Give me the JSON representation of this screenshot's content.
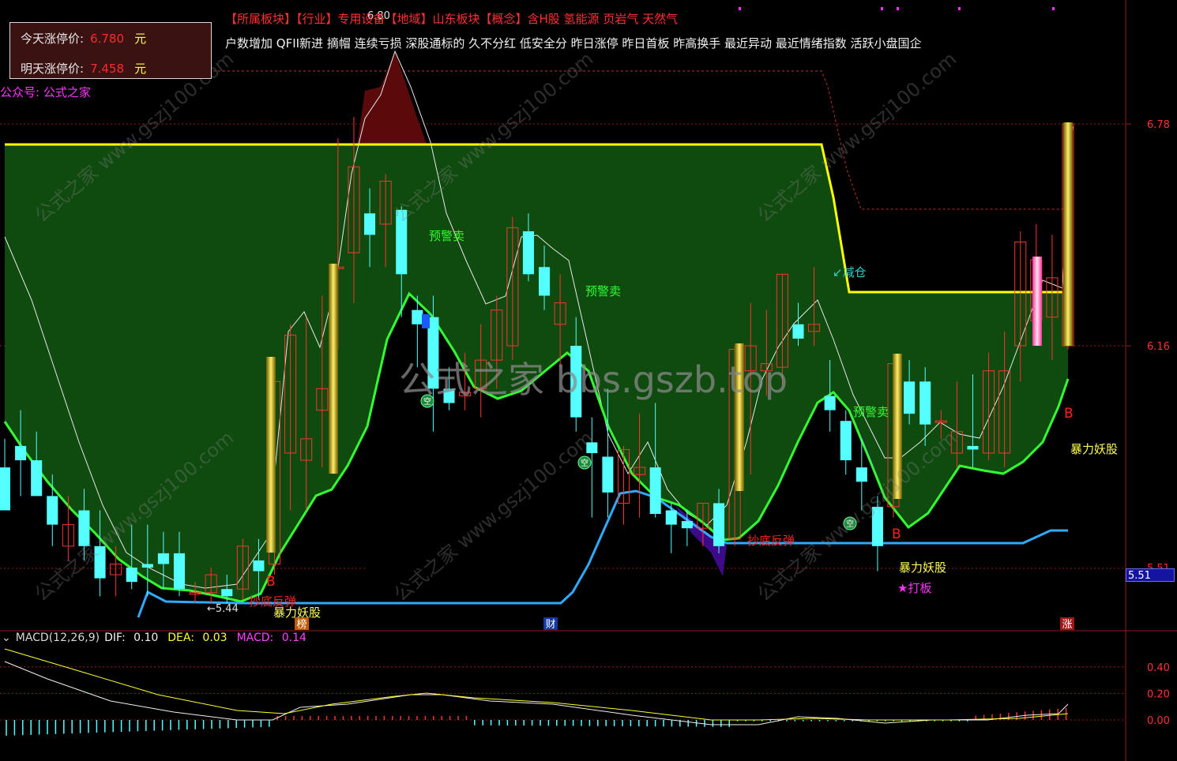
{
  "header_line1": "【所属板块】【行业】专用设备【地域】山东板块【概念】含H股 氢能源 页岩气 天然气",
  "header_line2": "户数增加 QFII新进 摘帽 连续亏损 深股通标的 久不分红 低安全分 昨日涨停 昨日首板 昨高换手 最近异动 最近情绪指数 活跃小盘国企",
  "limit_box": {
    "today_label": "今天涨停价:",
    "today_value": "6.780",
    "tomorrow_label": "明天涨停价:",
    "tomorrow_value": "7.458",
    "unit": "元"
  },
  "wechat_label": "公众号: 公式之家",
  "watermark_center": "公式之家 bbs.gszb.top",
  "watermark_small": "公式之家 www.gszj100.com",
  "price_axis": {
    "ticks": [
      "6.78",
      "6.16"
    ],
    "partial_tick": "5.51",
    "current_badge": "5.51"
  },
  "annotations": {
    "warn_sell": "预警卖",
    "reduce": "减仓",
    "bottom_rebound": "抄底反弹",
    "violent_monster": "暴力妖股",
    "hit_board": "★打板",
    "buy": "B",
    "empty": "空",
    "low_marker": "5.44",
    "high_marker": "6.80",
    "bottom_tag_bang": "榜",
    "bottom_tag_cai": "财",
    "bottom_tag_zhang": "涨"
  },
  "macd": {
    "indicator_label": "MACD(12,26,9)",
    "dif_label": "DIF:",
    "dif_value": "0.10",
    "dea_label": "DEA:",
    "dea_value": "0.03",
    "macd_label": "MACD:",
    "macd_value": "0.14",
    "ticks": [
      "0.40",
      "0.20",
      "0.00"
    ]
  },
  "colors": {
    "up": "#ff3232",
    "down": "#54ffff",
    "green_fill": "#0f4a0f",
    "yellow_line": "#ffff00",
    "green_line": "#33ff33",
    "blue_line": "#2eaaff",
    "dark_red": "#5a0a0a",
    "grid": "#9a1a1a"
  },
  "chart_data": {
    "type": "candlestick",
    "price_axis_ticks": [
      6.78,
      6.16
    ],
    "price_range": [
      5.4,
      6.85
    ],
    "candles": [
      {
        "o": 5.82,
        "h": 5.9,
        "l": 5.7,
        "c": 5.7
      },
      {
        "o": 5.88,
        "h": 5.98,
        "l": 5.74,
        "c": 5.84
      },
      {
        "o": 5.84,
        "h": 5.92,
        "l": 5.74,
        "c": 5.74
      },
      {
        "o": 5.74,
        "h": 5.8,
        "l": 5.6,
        "c": 5.66
      },
      {
        "o": 5.6,
        "h": 5.74,
        "l": 5.56,
        "c": 5.66
      },
      {
        "o": 5.7,
        "h": 5.76,
        "l": 5.56,
        "c": 5.6
      },
      {
        "o": 5.6,
        "h": 5.7,
        "l": 5.46,
        "c": 5.51
      },
      {
        "o": 5.52,
        "h": 5.6,
        "l": 5.46,
        "c": 5.55
      },
      {
        "o": 5.54,
        "h": 5.66,
        "l": 5.48,
        "c": 5.5
      },
      {
        "o": 5.55,
        "h": 5.66,
        "l": 5.46,
        "c": 5.54
      },
      {
        "o": 5.58,
        "h": 5.64,
        "l": 5.48,
        "c": 5.55
      },
      {
        "o": 5.58,
        "h": 5.64,
        "l": 5.46,
        "c": 5.48
      },
      {
        "o": 5.47,
        "h": 5.5,
        "l": 5.44,
        "c": 5.47
      },
      {
        "o": 5.47,
        "h": 5.54,
        "l": 5.44,
        "c": 5.52
      },
      {
        "o": 5.48,
        "h": 5.52,
        "l": 5.44,
        "c": 5.46
      },
      {
        "o": 5.48,
        "h": 5.62,
        "l": 5.45,
        "c": 5.6
      },
      {
        "o": 5.56,
        "h": 5.62,
        "l": 5.45,
        "c": 5.53
      },
      {
        "o": 5.55,
        "h": 6.1,
        "l": 5.52,
        "c": 6.06
      },
      {
        "o": 5.86,
        "h": 6.22,
        "l": 5.7,
        "c": 6.19
      },
      {
        "o": 5.84,
        "h": 6.24,
        "l": 5.7,
        "c": 5.9
      },
      {
        "o": 5.98,
        "h": 6.3,
        "l": 5.82,
        "c": 6.04
      },
      {
        "o": 6.38,
        "h": 6.74,
        "l": 6.15,
        "c": 6.38
      },
      {
        "o": 6.42,
        "h": 6.8,
        "l": 6.28,
        "c": 6.66
      },
      {
        "o": 6.53,
        "h": 6.6,
        "l": 6.38,
        "c": 6.47
      },
      {
        "o": 6.5,
        "h": 6.64,
        "l": 6.38,
        "c": 6.62
      },
      {
        "o": 6.54,
        "h": 6.55,
        "l": 6.24,
        "c": 6.36
      },
      {
        "o": 6.26,
        "h": 6.3,
        "l": 6.1,
        "c": 6.22
      },
      {
        "o": 6.24,
        "h": 6.3,
        "l": 5.92,
        "c": 6.04
      },
      {
        "o": 6.04,
        "h": 6.1,
        "l": 5.98,
        "c": 6.0
      },
      {
        "o": 6.02,
        "h": 6.14,
        "l": 5.98,
        "c": 6.03
      },
      {
        "o": 6.04,
        "h": 6.22,
        "l": 5.96,
        "c": 6.12
      },
      {
        "o": 6.12,
        "h": 6.3,
        "l": 6.04,
        "c": 6.26
      },
      {
        "o": 6.16,
        "h": 6.52,
        "l": 6.12,
        "c": 6.49
      },
      {
        "o": 6.48,
        "h": 6.53,
        "l": 6.34,
        "c": 6.36
      },
      {
        "o": 6.38,
        "h": 6.44,
        "l": 6.26,
        "c": 6.3
      },
      {
        "o": 6.22,
        "h": 6.36,
        "l": 6.1,
        "c": 6.28
      },
      {
        "o": 6.16,
        "h": 6.24,
        "l": 5.92,
        "c": 5.96
      },
      {
        "o": 5.89,
        "h": 5.96,
        "l": 5.68,
        "c": 5.86
      },
      {
        "o": 5.85,
        "h": 6.04,
        "l": 5.68,
        "c": 5.75
      },
      {
        "o": 5.72,
        "h": 5.88,
        "l": 5.66,
        "c": 5.87
      },
      {
        "o": 5.8,
        "h": 5.97,
        "l": 5.68,
        "c": 5.82
      },
      {
        "o": 5.82,
        "h": 6.0,
        "l": 5.68,
        "c": 5.69
      },
      {
        "o": 5.7,
        "h": 5.72,
        "l": 5.58,
        "c": 5.66
      },
      {
        "o": 5.67,
        "h": 5.7,
        "l": 5.6,
        "c": 5.65
      },
      {
        "o": 5.65,
        "h": 5.72,
        "l": 5.6,
        "c": 5.72
      },
      {
        "o": 5.72,
        "h": 5.76,
        "l": 5.58,
        "c": 5.6
      },
      {
        "o": 5.62,
        "h": 6.16,
        "l": 5.6,
        "c": 6.15
      },
      {
        "o": 6.09,
        "h": 6.28,
        "l": 5.8,
        "c": 6.16
      },
      {
        "o": 6.09,
        "h": 6.26,
        "l": 6.02,
        "c": 6.11
      },
      {
        "o": 6.1,
        "h": 6.36,
        "l": 6.05,
        "c": 6.36
      },
      {
        "o": 6.22,
        "h": 6.28,
        "l": 6.16,
        "c": 6.18
      },
      {
        "o": 6.2,
        "h": 6.38,
        "l": 6.16,
        "c": 6.22
      },
      {
        "o": 6.02,
        "h": 6.12,
        "l": 5.92,
        "c": 5.98
      },
      {
        "o": 5.95,
        "h": 5.98,
        "l": 5.8,
        "c": 5.84
      },
      {
        "o": 5.82,
        "h": 5.9,
        "l": 5.7,
        "c": 5.78
      },
      {
        "o": 5.71,
        "h": 5.74,
        "l": 5.53,
        "c": 5.6
      },
      {
        "o": 5.71,
        "h": 6.13,
        "l": 5.68,
        "c": 6.11
      },
      {
        "o": 6.06,
        "h": 6.12,
        "l": 5.94,
        "c": 5.97
      },
      {
        "o": 6.06,
        "h": 6.1,
        "l": 5.88,
        "c": 5.94
      },
      {
        "o": 5.95,
        "h": 5.98,
        "l": 5.9,
        "c": 5.95
      },
      {
        "o": 5.86,
        "h": 6.06,
        "l": 5.82,
        "c": 5.92
      },
      {
        "o": 5.88,
        "h": 6.08,
        "l": 5.82,
        "c": 5.87
      },
      {
        "o": 5.86,
        "h": 6.14,
        "l": 5.84,
        "c": 6.09
      },
      {
        "o": 5.86,
        "h": 6.2,
        "l": 5.82,
        "c": 6.09
      },
      {
        "o": 6.16,
        "h": 6.48,
        "l": 6.06,
        "c": 6.45
      },
      {
        "o": 6.23,
        "h": 6.5,
        "l": 6.2,
        "c": 6.4
      },
      {
        "o": 6.24,
        "h": 6.47,
        "l": 6.12,
        "c": 6.35
      },
      {
        "o": 6.16,
        "h": 6.78,
        "l": 6.15,
        "c": 6.78
      }
    ],
    "series": [
      {
        "name": "",
        "values": []
      }
    ],
    "resistance_levels": [
      6.74,
      6.33
    ],
    "support_levels": [
      5.48,
      5.61
    ],
    "macd_axis_ticks": [
      0.4,
      0.2,
      0.0
    ],
    "macd_values": {
      "dif": 0.1,
      "dea": 0.03,
      "macd": 0.14
    }
  }
}
